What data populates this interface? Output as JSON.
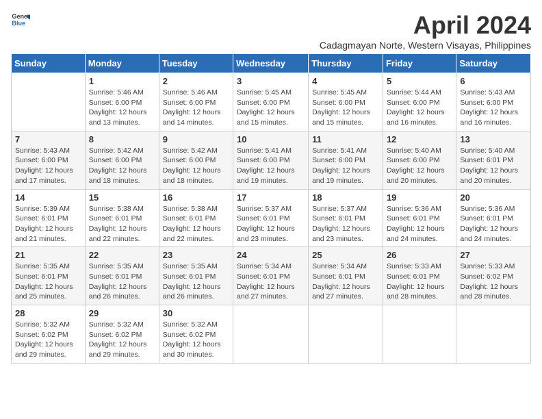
{
  "header": {
    "logo_general": "General",
    "logo_blue": "Blue",
    "month_title": "April 2024",
    "subtitle": "Cadagmayan Norte, Western Visayas, Philippines"
  },
  "weekdays": [
    "Sunday",
    "Monday",
    "Tuesday",
    "Wednesday",
    "Thursday",
    "Friday",
    "Saturday"
  ],
  "weeks": [
    [
      {
        "day": "",
        "sunrise": "",
        "sunset": "",
        "daylight": ""
      },
      {
        "day": "1",
        "sunrise": "Sunrise: 5:46 AM",
        "sunset": "Sunset: 6:00 PM",
        "daylight": "Daylight: 12 hours and 13 minutes."
      },
      {
        "day": "2",
        "sunrise": "Sunrise: 5:46 AM",
        "sunset": "Sunset: 6:00 PM",
        "daylight": "Daylight: 12 hours and 14 minutes."
      },
      {
        "day": "3",
        "sunrise": "Sunrise: 5:45 AM",
        "sunset": "Sunset: 6:00 PM",
        "daylight": "Daylight: 12 hours and 15 minutes."
      },
      {
        "day": "4",
        "sunrise": "Sunrise: 5:45 AM",
        "sunset": "Sunset: 6:00 PM",
        "daylight": "Daylight: 12 hours and 15 minutes."
      },
      {
        "day": "5",
        "sunrise": "Sunrise: 5:44 AM",
        "sunset": "Sunset: 6:00 PM",
        "daylight": "Daylight: 12 hours and 16 minutes."
      },
      {
        "day": "6",
        "sunrise": "Sunrise: 5:43 AM",
        "sunset": "Sunset: 6:00 PM",
        "daylight": "Daylight: 12 hours and 16 minutes."
      }
    ],
    [
      {
        "day": "7",
        "sunrise": "Sunrise: 5:43 AM",
        "sunset": "Sunset: 6:00 PM",
        "daylight": "Daylight: 12 hours and 17 minutes."
      },
      {
        "day": "8",
        "sunrise": "Sunrise: 5:42 AM",
        "sunset": "Sunset: 6:00 PM",
        "daylight": "Daylight: 12 hours and 18 minutes."
      },
      {
        "day": "9",
        "sunrise": "Sunrise: 5:42 AM",
        "sunset": "Sunset: 6:00 PM",
        "daylight": "Daylight: 12 hours and 18 minutes."
      },
      {
        "day": "10",
        "sunrise": "Sunrise: 5:41 AM",
        "sunset": "Sunset: 6:00 PM",
        "daylight": "Daylight: 12 hours and 19 minutes."
      },
      {
        "day": "11",
        "sunrise": "Sunrise: 5:41 AM",
        "sunset": "Sunset: 6:00 PM",
        "daylight": "Daylight: 12 hours and 19 minutes."
      },
      {
        "day": "12",
        "sunrise": "Sunrise: 5:40 AM",
        "sunset": "Sunset: 6:00 PM",
        "daylight": "Daylight: 12 hours and 20 minutes."
      },
      {
        "day": "13",
        "sunrise": "Sunrise: 5:40 AM",
        "sunset": "Sunset: 6:01 PM",
        "daylight": "Daylight: 12 hours and 20 minutes."
      }
    ],
    [
      {
        "day": "14",
        "sunrise": "Sunrise: 5:39 AM",
        "sunset": "Sunset: 6:01 PM",
        "daylight": "Daylight: 12 hours and 21 minutes."
      },
      {
        "day": "15",
        "sunrise": "Sunrise: 5:38 AM",
        "sunset": "Sunset: 6:01 PM",
        "daylight": "Daylight: 12 hours and 22 minutes."
      },
      {
        "day": "16",
        "sunrise": "Sunrise: 5:38 AM",
        "sunset": "Sunset: 6:01 PM",
        "daylight": "Daylight: 12 hours and 22 minutes."
      },
      {
        "day": "17",
        "sunrise": "Sunrise: 5:37 AM",
        "sunset": "Sunset: 6:01 PM",
        "daylight": "Daylight: 12 hours and 23 minutes."
      },
      {
        "day": "18",
        "sunrise": "Sunrise: 5:37 AM",
        "sunset": "Sunset: 6:01 PM",
        "daylight": "Daylight: 12 hours and 23 minutes."
      },
      {
        "day": "19",
        "sunrise": "Sunrise: 5:36 AM",
        "sunset": "Sunset: 6:01 PM",
        "daylight": "Daylight: 12 hours and 24 minutes."
      },
      {
        "day": "20",
        "sunrise": "Sunrise: 5:36 AM",
        "sunset": "Sunset: 6:01 PM",
        "daylight": "Daylight: 12 hours and 24 minutes."
      }
    ],
    [
      {
        "day": "21",
        "sunrise": "Sunrise: 5:35 AM",
        "sunset": "Sunset: 6:01 PM",
        "daylight": "Daylight: 12 hours and 25 minutes."
      },
      {
        "day": "22",
        "sunrise": "Sunrise: 5:35 AM",
        "sunset": "Sunset: 6:01 PM",
        "daylight": "Daylight: 12 hours and 26 minutes."
      },
      {
        "day": "23",
        "sunrise": "Sunrise: 5:35 AM",
        "sunset": "Sunset: 6:01 PM",
        "daylight": "Daylight: 12 hours and 26 minutes."
      },
      {
        "day": "24",
        "sunrise": "Sunrise: 5:34 AM",
        "sunset": "Sunset: 6:01 PM",
        "daylight": "Daylight: 12 hours and 27 minutes."
      },
      {
        "day": "25",
        "sunrise": "Sunrise: 5:34 AM",
        "sunset": "Sunset: 6:01 PM",
        "daylight": "Daylight: 12 hours and 27 minutes."
      },
      {
        "day": "26",
        "sunrise": "Sunrise: 5:33 AM",
        "sunset": "Sunset: 6:01 PM",
        "daylight": "Daylight: 12 hours and 28 minutes."
      },
      {
        "day": "27",
        "sunrise": "Sunrise: 5:33 AM",
        "sunset": "Sunset: 6:02 PM",
        "daylight": "Daylight: 12 hours and 28 minutes."
      }
    ],
    [
      {
        "day": "28",
        "sunrise": "Sunrise: 5:32 AM",
        "sunset": "Sunset: 6:02 PM",
        "daylight": "Daylight: 12 hours and 29 minutes."
      },
      {
        "day": "29",
        "sunrise": "Sunrise: 5:32 AM",
        "sunset": "Sunset: 6:02 PM",
        "daylight": "Daylight: 12 hours and 29 minutes."
      },
      {
        "day": "30",
        "sunrise": "Sunrise: 5:32 AM",
        "sunset": "Sunset: 6:02 PM",
        "daylight": "Daylight: 12 hours and 30 minutes."
      },
      {
        "day": "",
        "sunrise": "",
        "sunset": "",
        "daylight": ""
      },
      {
        "day": "",
        "sunrise": "",
        "sunset": "",
        "daylight": ""
      },
      {
        "day": "",
        "sunrise": "",
        "sunset": "",
        "daylight": ""
      },
      {
        "day": "",
        "sunrise": "",
        "sunset": "",
        "daylight": ""
      }
    ]
  ]
}
